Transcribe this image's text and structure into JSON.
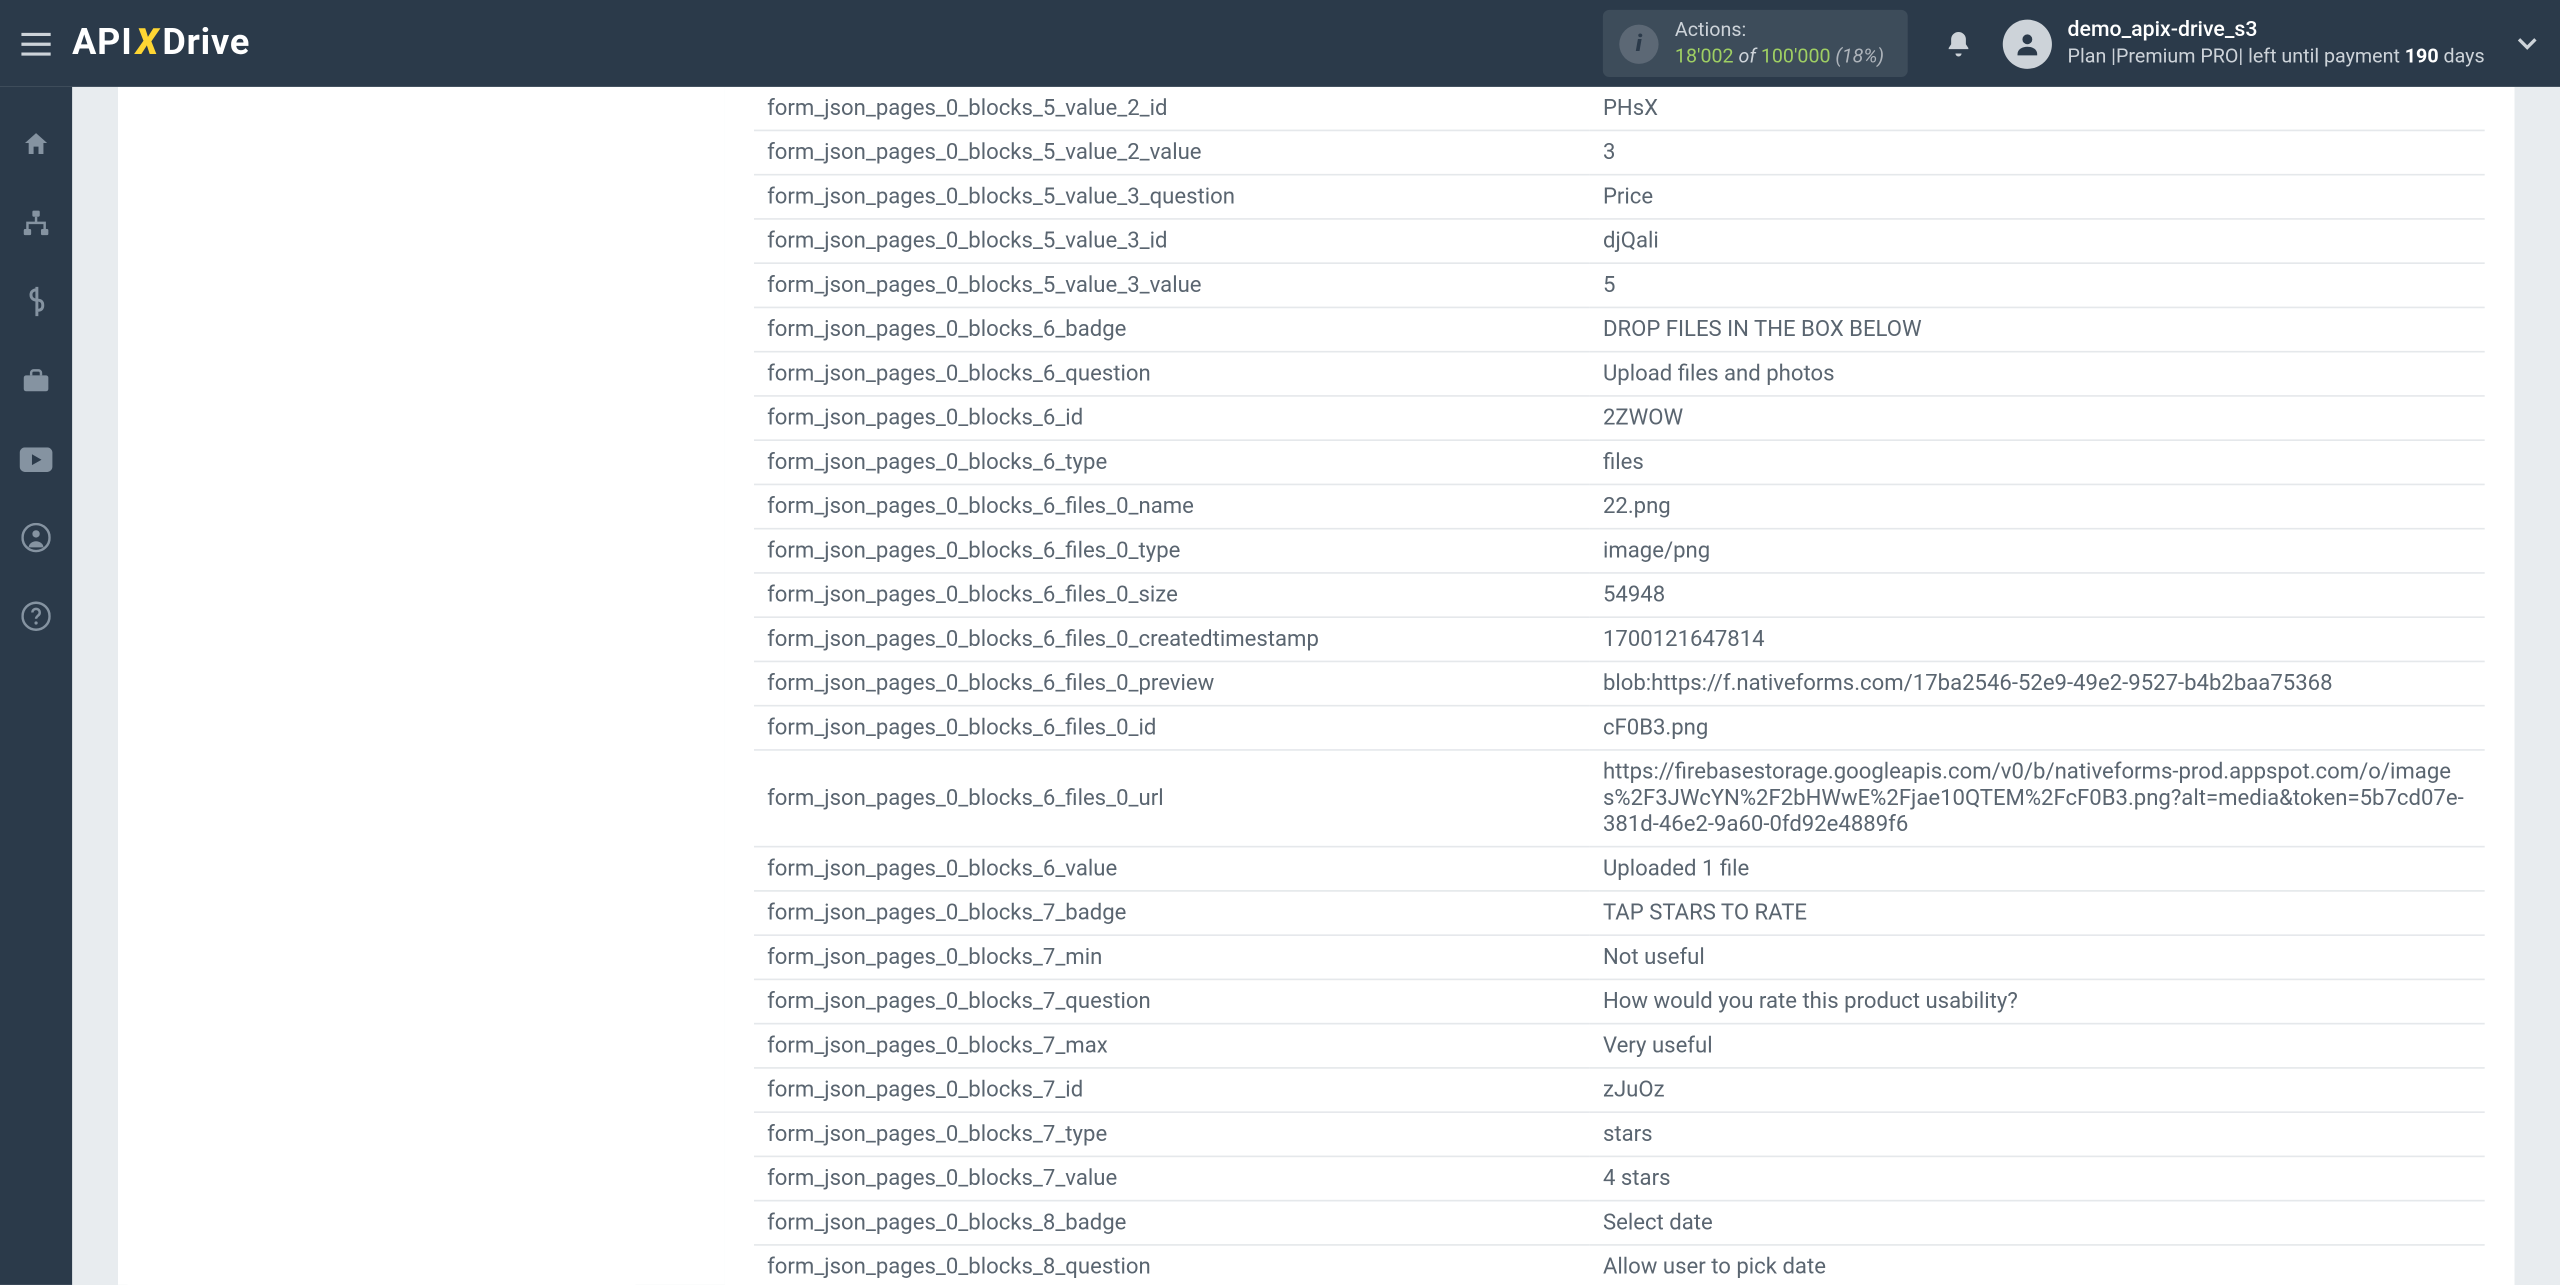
{
  "header": {
    "logo_api": "API",
    "logo_x": "X",
    "logo_drive": "Drive",
    "actions_label": "Actions:",
    "actions_count": "18'002",
    "actions_of": " of ",
    "actions_total": "100'000",
    "actions_pct": " (18%)",
    "username": "demo_apix-drive_s3",
    "plan_label": "Plan |",
    "plan_name": "Premium PRO",
    "plan_sep": "| left until payment ",
    "plan_days_num": "190",
    "plan_days_unit": " days"
  },
  "rows": [
    {
      "k": "form_json_pages_0_blocks_5_value_2_id",
      "v": "PHsX"
    },
    {
      "k": "form_json_pages_0_blocks_5_value_2_value",
      "v": "3"
    },
    {
      "k": "form_json_pages_0_blocks_5_value_3_question",
      "v": "Price"
    },
    {
      "k": "form_json_pages_0_blocks_5_value_3_id",
      "v": "djQali"
    },
    {
      "k": "form_json_pages_0_blocks_5_value_3_value",
      "v": "5"
    },
    {
      "k": "form_json_pages_0_blocks_6_badge",
      "v": "DROP FILES IN THE BOX BELOW"
    },
    {
      "k": "form_json_pages_0_blocks_6_question",
      "v": "Upload files and photos"
    },
    {
      "k": "form_json_pages_0_blocks_6_id",
      "v": "2ZWOW"
    },
    {
      "k": "form_json_pages_0_blocks_6_type",
      "v": "files"
    },
    {
      "k": "form_json_pages_0_blocks_6_files_0_name",
      "v": "22.png"
    },
    {
      "k": "form_json_pages_0_blocks_6_files_0_type",
      "v": "image/png"
    },
    {
      "k": "form_json_pages_0_blocks_6_files_0_size",
      "v": "54948"
    },
    {
      "k": "form_json_pages_0_blocks_6_files_0_createdtimestamp",
      "v": "1700121647814"
    },
    {
      "k": "form_json_pages_0_blocks_6_files_0_preview",
      "v": "blob:https://f.nativeforms.com/17ba2546-52e9-49e2-9527-b4b2baa75368"
    },
    {
      "k": "form_json_pages_0_blocks_6_files_0_id",
      "v": "cF0B3.png"
    },
    {
      "k": "form_json_pages_0_blocks_6_files_0_url",
      "v": "https://firebasestorage.googleapis.com/v0/b/nativeforms-prod.appspot.com/o/images%2F3JWcYN%2F2bHWwE%2Fjae10QTEM%2FcF0B3.png?alt=media&token=5b7cd07e-381d-46e2-9a60-0fd92e4889f6"
    },
    {
      "k": "form_json_pages_0_blocks_6_value",
      "v": "Uploaded 1 file"
    },
    {
      "k": "form_json_pages_0_blocks_7_badge",
      "v": "TAP STARS TO RATE"
    },
    {
      "k": "form_json_pages_0_blocks_7_min",
      "v": "Not useful"
    },
    {
      "k": "form_json_pages_0_blocks_7_question",
      "v": "How would you rate this product usability?"
    },
    {
      "k": "form_json_pages_0_blocks_7_max",
      "v": "Very useful"
    },
    {
      "k": "form_json_pages_0_blocks_7_id",
      "v": "zJuOz"
    },
    {
      "k": "form_json_pages_0_blocks_7_type",
      "v": "stars"
    },
    {
      "k": "form_json_pages_0_blocks_7_value",
      "v": "4 stars"
    },
    {
      "k": "form_json_pages_0_blocks_8_badge",
      "v": "Select date"
    },
    {
      "k": "form_json_pages_0_blocks_8_question",
      "v": "Allow user to pick date"
    }
  ]
}
